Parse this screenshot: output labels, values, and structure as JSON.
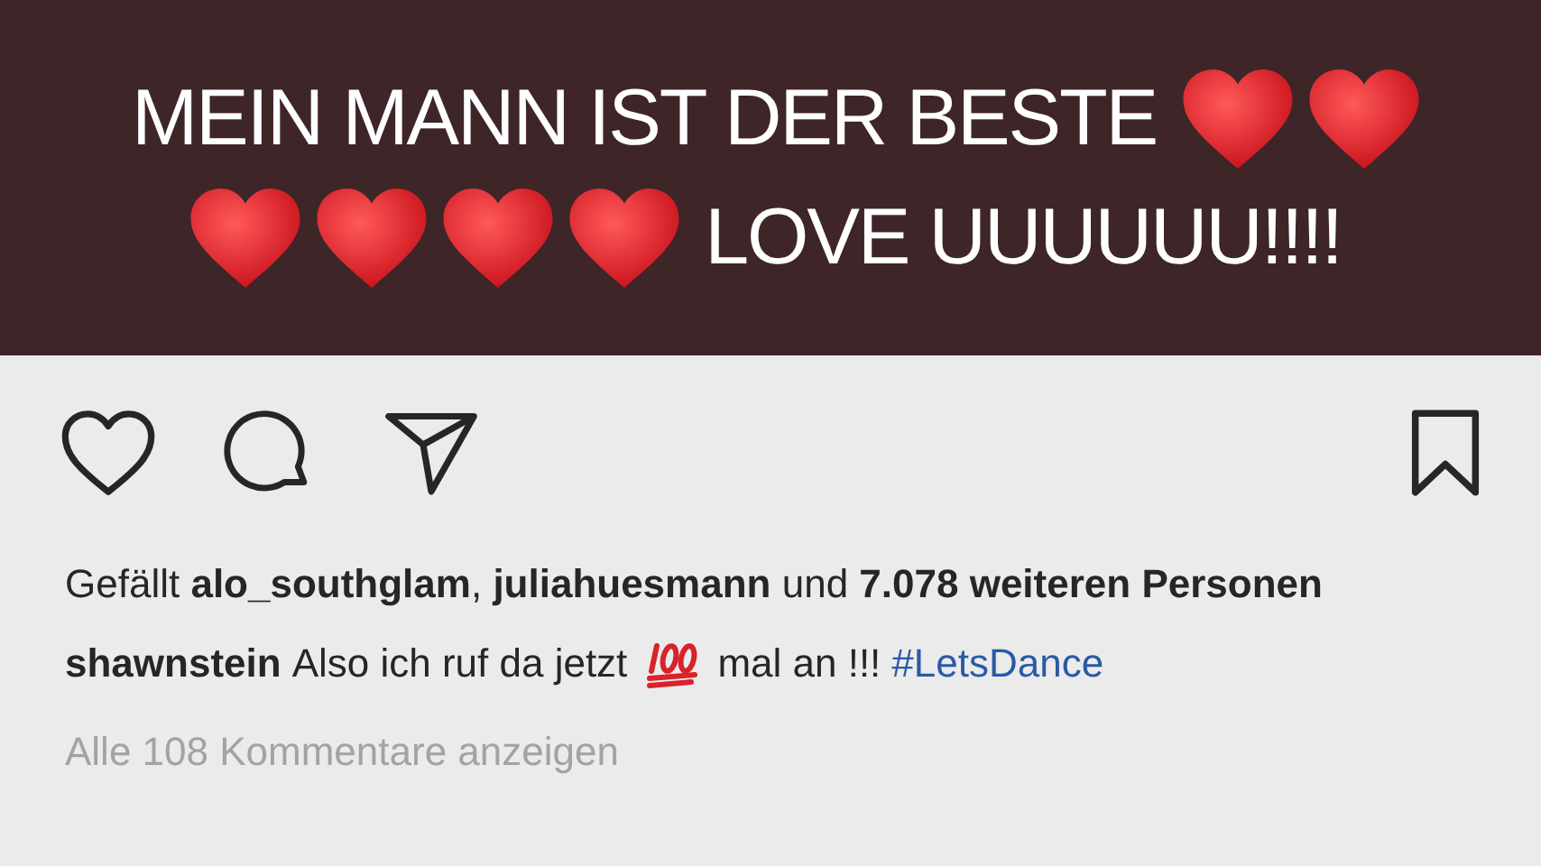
{
  "story_image": {
    "lines": [
      [
        {
          "kind": "text",
          "text": "MEIN MANN IST DER BESTE"
        },
        {
          "kind": "heart"
        },
        {
          "kind": "heart"
        }
      ],
      [
        {
          "kind": "heart"
        },
        {
          "kind": "heart"
        },
        {
          "kind": "heart"
        },
        {
          "kind": "heart"
        },
        {
          "kind": "text",
          "text": "LOVE UUUUUU!!!!"
        }
      ]
    ]
  },
  "actions": {
    "liked": false,
    "saved": false
  },
  "likes": "Gefällt **alo_southglam**, **juliahuesmann** und **7.078 weiteren Personen**",
  "caption": [
    {
      "kind": "username",
      "text": "shawnstein"
    },
    {
      "kind": "text",
      "text": "Also ich ruf da jetzt"
    },
    {
      "kind": "emoji_100"
    },
    {
      "kind": "text",
      "text": "mal an !!!"
    },
    {
      "kind": "hashtag",
      "text": "#LetsDance"
    }
  ],
  "comments_link": "Alle 108 Kommentare anzeigen"
}
